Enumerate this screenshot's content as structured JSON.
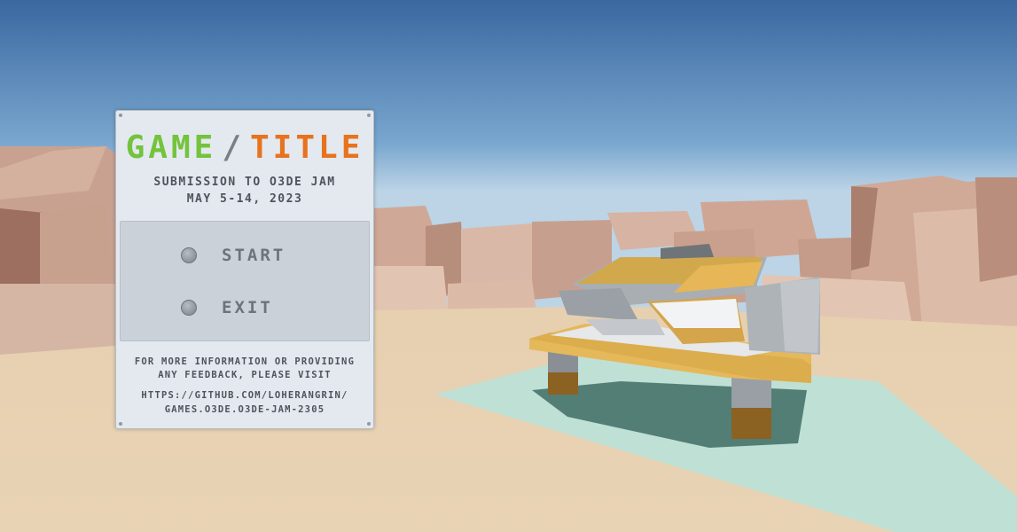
{
  "game": {
    "title_left": "GAME",
    "title_sep": "/",
    "title_right": "TITLE",
    "subtitle_line1": "SUBMISSION TO O3DE JAM",
    "subtitle_line2": "MAY 5-14, 2023"
  },
  "menu": {
    "items": [
      {
        "label": "START"
      },
      {
        "label": "EXIT"
      }
    ]
  },
  "footer": {
    "info_line1": "FOR MORE INFORMATION OR PROVIDING",
    "info_line2": "ANY FEEDBACK, PLEASE VISIT",
    "url_line1": "HTTPS://GITHUB.COM/LOHERANGRIN/",
    "url_line2": "GAMES.O3DE.O3DE-JAM-2305"
  },
  "colors": {
    "title_green": "#74c33c",
    "title_orange": "#e8731e",
    "panel_bg": "#e4e9ef",
    "sky_top": "#3a68a0",
    "sand": "#e8d2b2"
  }
}
